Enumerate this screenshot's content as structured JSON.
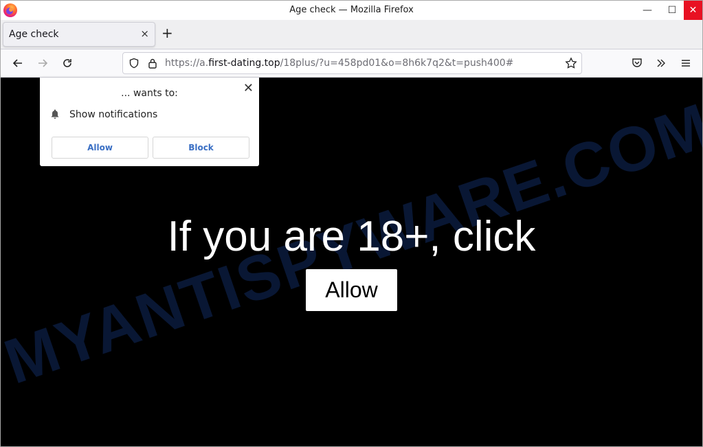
{
  "window": {
    "title": "Age check — Mozilla Firefox",
    "controls": {
      "minimize": "—",
      "maximize": "☐",
      "close": "✕"
    }
  },
  "tabs": [
    {
      "label": "Age check",
      "active": true,
      "close": "×"
    }
  ],
  "new_tab_label": "+",
  "nav": {
    "back": "←",
    "forward": "→",
    "reload": "↻",
    "url": {
      "scheme": "https://a.",
      "host": "first-dating.top",
      "path": "/18plus/?u=458pd01&o=8h6k7q2&t=push400#"
    }
  },
  "permission_popup": {
    "heading": "... wants to:",
    "permission": "Show notifications",
    "allow_label": "Allow",
    "block_label": "Block",
    "close": "✕"
  },
  "page": {
    "headline": "If you are 18+, click",
    "allow_button": "Allow",
    "watermark": "MYANTISPYWARE.COM"
  }
}
